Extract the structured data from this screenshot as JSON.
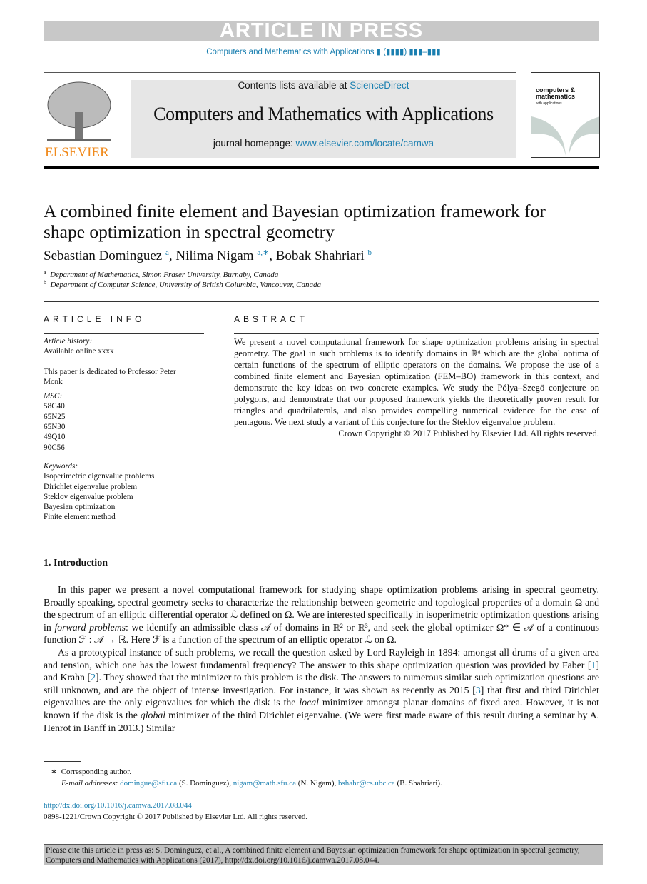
{
  "header": {
    "banner": "ARTICLE IN PRESS",
    "journal_line": "Computers and Mathematics with Applications ▮ (▮▮▮▮) ▮▮▮–▮▮▮",
    "contents_prefix": "Contents lists available at ",
    "contents_link": "ScienceDirect",
    "journal_title": "Computers and Mathematics with Applications",
    "homepage_prefix": "journal homepage: ",
    "homepage_link": "www.elsevier.com/locate/camwa",
    "publisher": "ELSEVIER",
    "cover_title": "computers & mathematics",
    "cover_sub": "with applications"
  },
  "article": {
    "title": "A combined finite element and Bayesian optimization framework for shape optimization in spectral geometry",
    "authors": [
      {
        "name": "Sebastian Dominguez",
        "sup": "a"
      },
      {
        "name": "Nilima Nigam",
        "sup": "a,∗"
      },
      {
        "name": "Bobak Shahriari",
        "sup": "b"
      }
    ],
    "affiliations": [
      {
        "mark": "a",
        "text": "Department of Mathematics, Simon Fraser University, Burnaby, Canada"
      },
      {
        "mark": "b",
        "text": "Department of Computer Science, University of British Columbia, Vancouver, Canada"
      }
    ]
  },
  "info": {
    "heading": "ARTICLE INFO",
    "history_label": "Article history:",
    "history": "Available online xxxx",
    "dedication": "This paper is dedicated to Professor Peter Monk",
    "msc_label": "MSC:",
    "msc": [
      "58C40",
      "65N25",
      "65N30",
      "49Q10",
      "90C56"
    ],
    "keywords_label": "Keywords:",
    "keywords": [
      "Isoperimetric eigenvalue problems",
      "Dirichlet eigenvalue problem",
      "Steklov eigenvalue problem",
      "Bayesian optimization",
      "Finite element method"
    ]
  },
  "abstract": {
    "heading": "ABSTRACT",
    "text": "We present a novel computational framework for shape optimization problems arising in spectral geometry. The goal in such problems is to identify domains in ℝᵈ which are the global optima of certain functions of the spectrum of elliptic operators on the domains. We propose the use of a combined finite element and Bayesian optimization (FEM–BO) framework in this context, and demonstrate the key ideas on two concrete examples. We study the Pólya–Szegö conjecture on polygons, and demonstrate that our proposed framework yields the theoretically proven result for triangles and quadrilaterals, and also provides compelling numerical evidence for the case of pentagons. We next study a variant of this conjecture for the Steklov eigenvalue problem.",
    "copyright": "Crown Copyright © 2017 Published by Elsevier Ltd. All rights reserved."
  },
  "intro": {
    "heading": "1.  Introduction",
    "p1": [
      "In this paper we present a novel computational framework for studying shape optimization problems arising in spectral geometry. Broadly speaking, spectral geometry seeks to characterize the relationship between geometric and topological properties of a domain Ω and the spectrum of an elliptic differential operator ℒ defined on Ω. We are interested specifically in isoperimetric optimization questions arising in ",
      "forward problems",
      ": we identify an admissible class 𝒜 of domains in ℝ² or ℝ³, and seek the global optimizer Ω* ∈ 𝒜 of a continuous function ℱ : 𝒜 → ℝ. Here ℱ is a function of the spectrum of an elliptic operator ℒ on Ω."
    ],
    "p2": [
      "As a prototypical instance of such problems, we recall the question asked by Lord Rayleigh in 1894: amongst all drums of a given area and tension, which one has the lowest fundamental frequency? The answer to this shape optimization question was provided by Faber [",
      "1",
      "] and Krahn [",
      "2",
      "]. They showed that the minimizer to this problem is the disk. The answers to numerous similar such optimization questions are still unknown, and are the object of intense investigation. For instance, it was shown as recently as 2015 [",
      "3",
      "] that first and third Dirichlet eigenvalues are the only eigenvalues for which the disk is the ",
      "local",
      " minimizer amongst planar domains of fixed area. However, it is not known if the disk is the ",
      "global",
      " minimizer of the third Dirichlet eigenvalue. (We were first made aware of this result during a seminar by A. Henrot in Banff in 2013.) Similar"
    ]
  },
  "footnote": {
    "star": "∗",
    "corr": "Corresponding author.",
    "email_label": "E-mail addresses:",
    "emails": [
      {
        "addr": "domingue@sfu.ca",
        "who": " (S. Dominguez), "
      },
      {
        "addr": "nigam@math.sfu.ca",
        "who": " (N. Nigam), "
      },
      {
        "addr": "bshahr@cs.ubc.ca",
        "who": " (B. Shahriari)."
      }
    ]
  },
  "doi": {
    "link": "http://dx.doi.org/10.1016/j.camwa.2017.08.044",
    "rights": "0898-1221/Crown Copyright © 2017 Published by Elsevier Ltd. All rights reserved."
  },
  "cite": "Please cite this article in press as: S. Dominguez, et al., A combined finite element and Bayesian optimization framework for shape optimization in spectral geometry, Computers and Mathematics with Applications (2017), http://dx.doi.org/10.1016/j.camwa.2017.08.044."
}
